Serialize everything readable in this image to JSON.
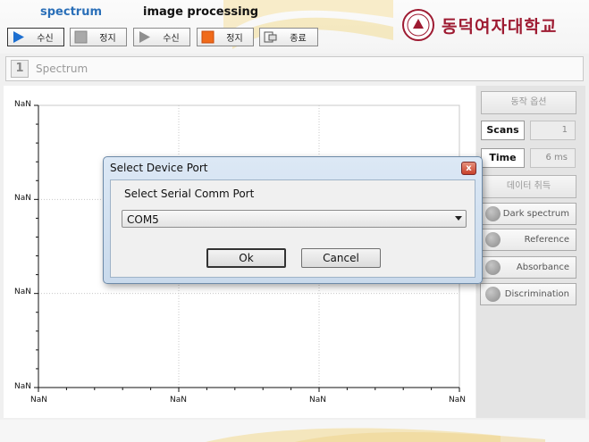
{
  "tabs": {
    "spectrum": "spectrum",
    "image": "image processing"
  },
  "toolbar": {
    "spectrum_receive": "수신",
    "spectrum_stop": "정지",
    "image_receive": "수신",
    "image_stop": "정지",
    "exit": "종료"
  },
  "logo": {
    "text": "동덕여자대학교"
  },
  "panel": {
    "number": "1",
    "title": "Spectrum"
  },
  "plot": {
    "y_tick_labels": [
      "NaN",
      "NaN",
      "NaN",
      "NaN"
    ],
    "x_tick_labels": [
      "NaN",
      "NaN",
      "NaN",
      "NaN"
    ]
  },
  "side": {
    "options_button": "동작 옵션",
    "scans_label": "Scans",
    "scans_value": "1",
    "time_label": "Time",
    "time_value": "6 ms",
    "acquire_button": "데이터 취득",
    "radio_buttons": [
      "Dark spectrum",
      "Reference",
      "Absorbance",
      "Discrimination"
    ]
  },
  "dialog": {
    "title": "Select Device Port",
    "close_glyph": "x",
    "prompt": "Select Serial Comm Port",
    "selected_port": "COM5",
    "ok_label": "Ok",
    "cancel_label": "Cancel"
  }
}
